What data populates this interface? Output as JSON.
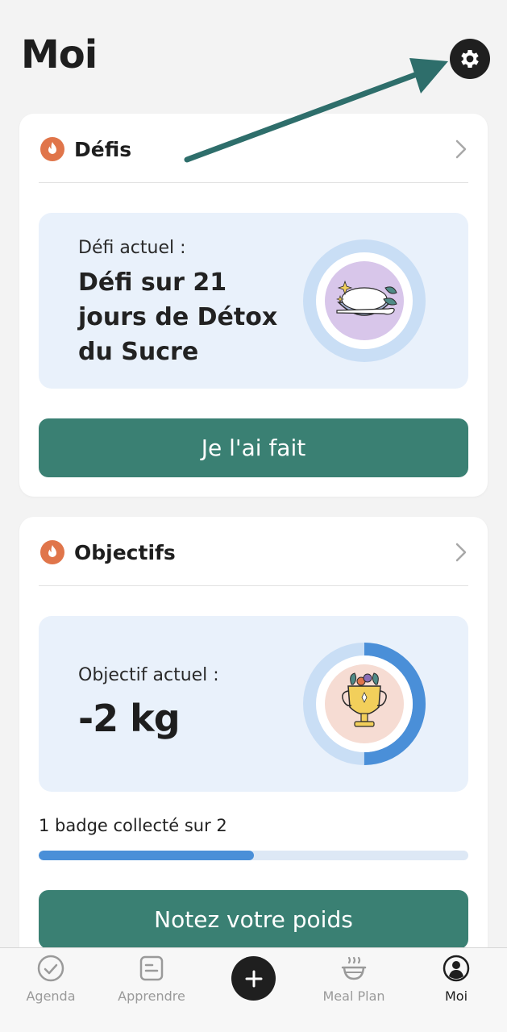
{
  "page": {
    "title": "Moi"
  },
  "challenges_card": {
    "title": "Défis",
    "current_label": "Défi actuel :",
    "current_name": "Défi sur 21 jours de Détox du Sucre",
    "button_label": "Je l'ai fait"
  },
  "goals_card": {
    "title": "Objectifs",
    "current_label": "Objectif actuel :",
    "current_value": "-2 kg",
    "badge_text": "1 badge collecté sur 2",
    "badge_progress": 0.5,
    "ring_progress": 0.5,
    "button_label": "Notez votre poids"
  },
  "tabbar": {
    "agenda": "Agenda",
    "apprendre": "Apprendre",
    "meal_plan": "Meal Plan",
    "moi": "Moi"
  },
  "colors": {
    "accent_green": "#3a8073",
    "flame_orange": "#e0754a",
    "progress_blue": "#4a8fd8",
    "panel_bg": "#e9f1fb",
    "arrow_teal": "#2e6e6b"
  }
}
